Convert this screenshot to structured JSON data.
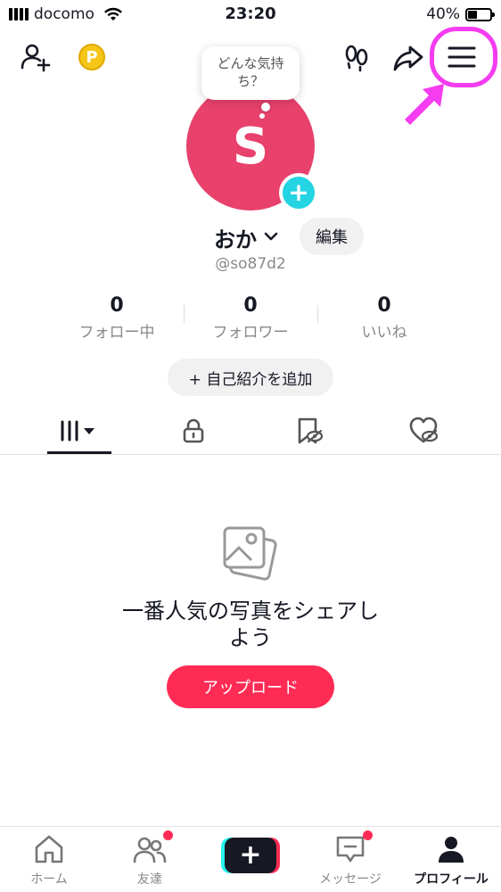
{
  "status_bar": {
    "carrier": "docomo",
    "time": "23:20",
    "battery_percent": "40%",
    "battery_level": 0.4
  },
  "toolbar": {
    "icons": [
      "add-friend-icon",
      "coin-icon",
      "footprints-icon",
      "share-icon",
      "menu-icon"
    ],
    "coin_letter": "P"
  },
  "profile": {
    "thought_bubble": "どんな気持ち？",
    "avatar_letter": "S",
    "avatar_color": "#e8416c",
    "add_badge_color": "#25d4e2",
    "display_name": "おか",
    "edit_label": "編集",
    "handle": "@so87d2",
    "stats": [
      {
        "value": "0",
        "label": "フォロー中"
      },
      {
        "value": "0",
        "label": "フォロワー"
      },
      {
        "value": "0",
        "label": "いいね"
      }
    ],
    "bio_button": "+ 自己紹介を追加"
  },
  "tabs": [
    "videos-grid-icon",
    "lock-icon",
    "saved-hidden-icon",
    "liked-hidden-icon"
  ],
  "empty_state": {
    "icon": "photos-icon",
    "message": "一番人気の写真をシェアしよう",
    "upload_label": "アップロード",
    "upload_color": "#fe2c55"
  },
  "bottom_nav": {
    "home": "ホーム",
    "friends": "友達",
    "create": "+",
    "messages": "メッセージ",
    "profile": "プロフィール"
  },
  "annotation": {
    "highlight_color": "#f53cf0",
    "target": "menu-icon"
  }
}
